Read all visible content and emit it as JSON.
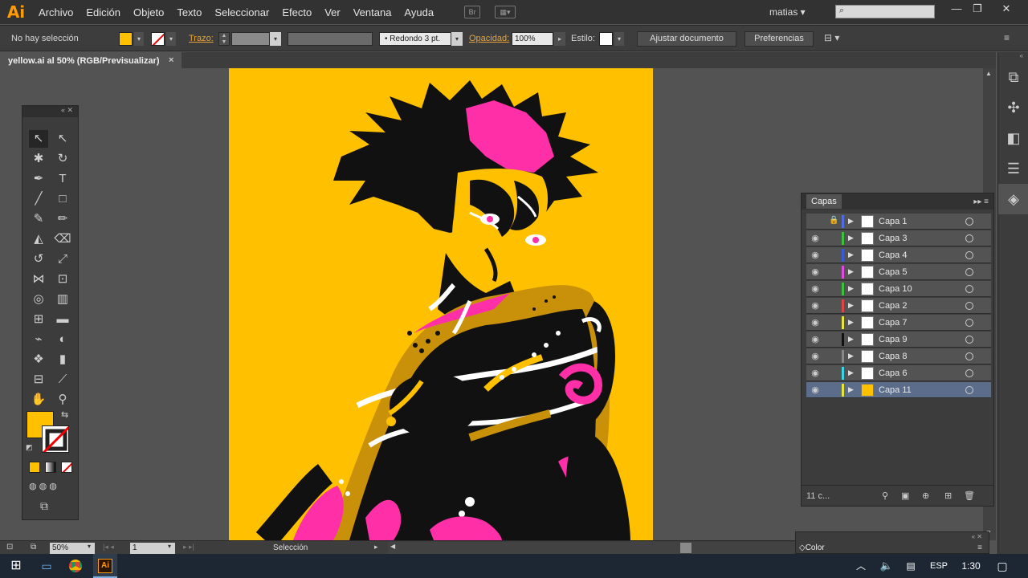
{
  "app": {
    "logo": "Ai"
  },
  "menu": [
    "Archivo",
    "Edición",
    "Objeto",
    "Texto",
    "Seleccionar",
    "Efecto",
    "Ver",
    "Ventana",
    "Ayuda"
  ],
  "bridge_icon": "Br",
  "user": "matias",
  "control": {
    "selection_status": "No hay selección",
    "stroke_label": "Trazo:",
    "brush_label": "Redondo 3 pt.",
    "opacity_label": "Opacidad:",
    "opacity_value": "100%",
    "style_label": "Estilo:",
    "adjust_button": "Ajustar documento",
    "prefs_button": "Preferencias"
  },
  "document": {
    "tab_title": "yellow.ai al 50% (RGB/Previsualizar)",
    "close": "×"
  },
  "colors": {
    "artboard": "#ffc000",
    "fill": "#ffc000",
    "accent_orange": "#ff9a00",
    "selected_row": "#5c6d8c"
  },
  "layers_panel": {
    "title": "Capas",
    "count": "11 c...",
    "layers": [
      {
        "name": "Capa 1",
        "color": "#4f6ee6",
        "locked": true,
        "visible": false
      },
      {
        "name": "Capa 3",
        "color": "#3ac33a",
        "locked": false,
        "visible": true
      },
      {
        "name": "Capa 4",
        "color": "#3a5bd9",
        "locked": false,
        "visible": true
      },
      {
        "name": "Capa 5",
        "color": "#e24ae2",
        "locked": false,
        "visible": true
      },
      {
        "name": "Capa 10",
        "color": "#3ac33a",
        "locked": false,
        "visible": true
      },
      {
        "name": "Capa 2",
        "color": "#e04545",
        "locked": false,
        "visible": true
      },
      {
        "name": "Capa 7",
        "color": "#e6e63a",
        "locked": false,
        "visible": true
      },
      {
        "name": "Capa 9",
        "color": "#111111",
        "locked": false,
        "visible": true
      },
      {
        "name": "Capa 8",
        "color": "#888888",
        "locked": false,
        "visible": true
      },
      {
        "name": "Capa 6",
        "color": "#3ad6e6",
        "locked": false,
        "visible": true
      },
      {
        "name": "Capa 11",
        "color": "#e6e63a",
        "locked": false,
        "visible": true,
        "selected": true
      }
    ]
  },
  "color_panel": {
    "title": "Color"
  },
  "status": {
    "zoom": "50%",
    "page": "1",
    "tool_status": "Selección"
  },
  "taskbar": {
    "lang": "ESP",
    "time": "1:30"
  }
}
